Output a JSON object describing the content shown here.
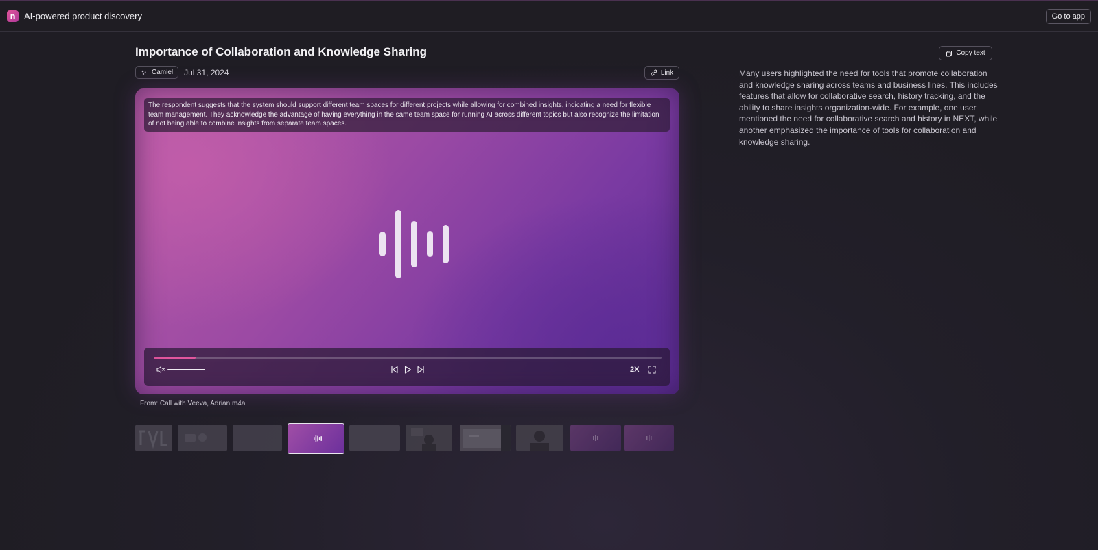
{
  "topbar": {
    "brand_name": "AI-powered product discovery",
    "logo_glyph": "n",
    "go_to_app_label": "Go to app"
  },
  "insight": {
    "title": "Importance of Collaboration and Knowledge Sharing",
    "author": "Camiel",
    "date": "Jul 31, 2024",
    "link_label": "Link",
    "copy_text_label": "Copy text",
    "summary": "Many users highlighted the need for tools that promote collaboration and knowledge sharing across teams and business lines. This includes features that allow for collaborative search, history tracking, and the ability to share insights organization-wide. For example, one user mentioned the need for collaborative search and history in NEXT, while another emphasized the importance of tools for collaboration and knowledge sharing."
  },
  "player": {
    "caption": "The respondent suggests that the system should support different team spaces for different projects while allowing for combined insights, indicating a need for flexible team management. They acknowledge the advantage of having everything in the same team space for running AI across different topics but also recognize the limitation of not being able to combine insights from separate team spaces.",
    "progress_fraction": 0.083,
    "volume_fraction": 1.0,
    "speed_label": "2X",
    "accent_color": "#e2569e",
    "source": "From: Call with Veeva, Adrian.m4a"
  },
  "thumbnails": {
    "count": 10,
    "active_index": 3
  }
}
